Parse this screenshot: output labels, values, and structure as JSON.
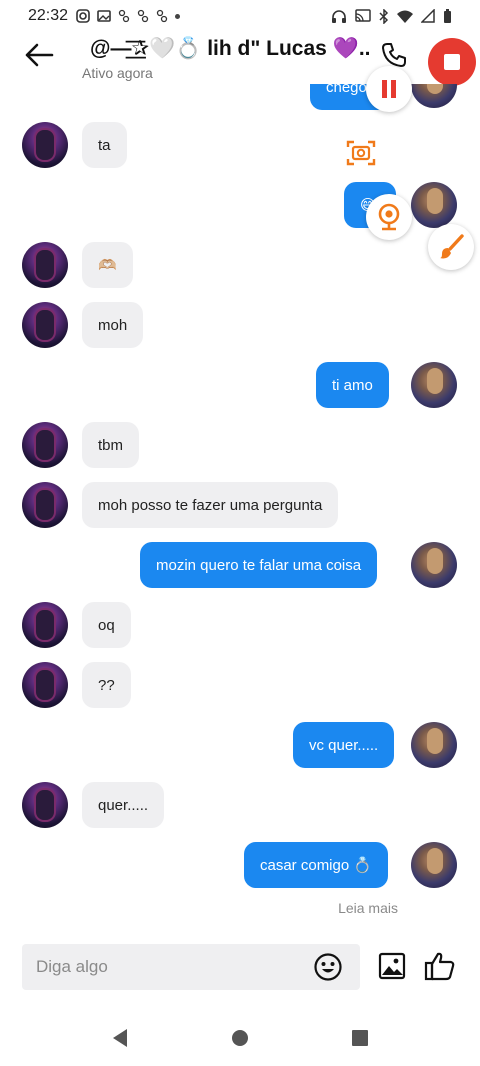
{
  "status_bar": {
    "time": "22:32"
  },
  "header": {
    "title": "@—͟͞✰🤍💍 lih d\" Lucas 💜...",
    "subtitle": "Ativo agora"
  },
  "messages": [
    {
      "dir": "out",
      "text": "chego"
    },
    {
      "dir": "in",
      "text": "ta"
    },
    {
      "dir": "out",
      "text": "😄"
    },
    {
      "dir": "in",
      "text": "🫶🏼"
    },
    {
      "dir": "in",
      "text": "moh"
    },
    {
      "dir": "out",
      "text": "ti amo"
    },
    {
      "dir": "in",
      "text": "tbm"
    },
    {
      "dir": "in",
      "text": "moh posso te fazer uma pergunta"
    },
    {
      "dir": "out",
      "text": "mozin quero te falar uma coisa"
    },
    {
      "dir": "in",
      "text": "oq"
    },
    {
      "dir": "in",
      "text": "??"
    },
    {
      "dir": "out",
      "text": "vc quer....."
    },
    {
      "dir": "in",
      "text": "quer....."
    },
    {
      "dir": "out",
      "text": "casar comigo 💍"
    }
  ],
  "read_more": "Leia mais",
  "composer": {
    "placeholder": "Diga algo"
  },
  "icons": {
    "back": "arrow-left-icon",
    "call": "phone-icon",
    "stop": "stop-record-icon",
    "pause": "pause-icon",
    "screenshot": "camera-frame-icon",
    "webcam": "webcam-icon",
    "brush": "brush-icon",
    "emoji": "emoji-icon",
    "image": "image-icon",
    "like": "thumbs-up-icon"
  },
  "colors": {
    "outgoing_bubble": "#1b88f0",
    "incoming_bubble": "#efeff1",
    "record_red": "#e53a30",
    "recorder_orange": "#f07a1a"
  }
}
